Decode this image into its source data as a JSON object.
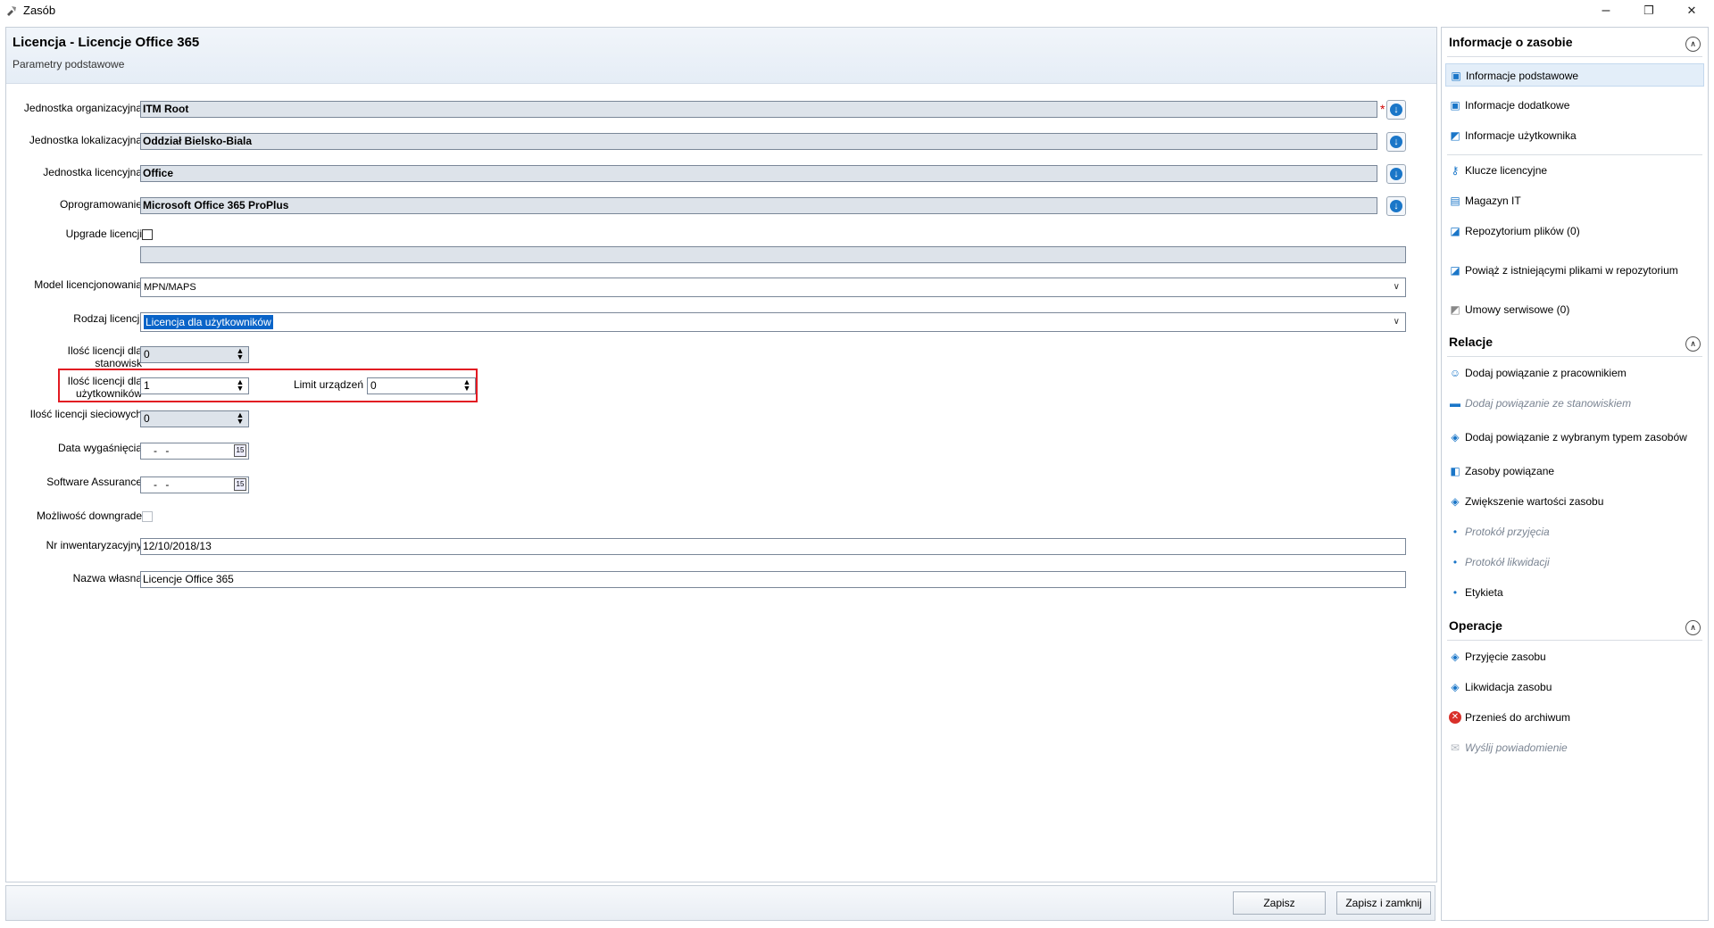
{
  "window": {
    "title": "Zasób",
    "minimize": "–",
    "restore": "❐",
    "close": "✕"
  },
  "header": {
    "title": "Licencja - Licencje Office 365",
    "subtitle": "Parametry podstawowe"
  },
  "form": {
    "jednostka_org": {
      "label": "Jednostka organizacyjna",
      "value": "ITM Root",
      "required": "*"
    },
    "jednostka_lok": {
      "label": "Jednostka lokalizacyjna",
      "value": "Oddział Bielsko-Biala"
    },
    "jednostka_lic": {
      "label": "Jednostka licencyjna",
      "value": "Office"
    },
    "oprogramowanie": {
      "label": "Oprogramowanie",
      "value": "Microsoft Office 365 ProPlus"
    },
    "upgrade": {
      "label": "Upgrade licencji"
    },
    "model": {
      "label": "Model licencjonowania",
      "value": "MPN/MAPS"
    },
    "rodzaj": {
      "label": "Rodzaj licencji",
      "value": "Licencja dla użytkowników"
    },
    "ilosc_stanowisk": {
      "label_line1": "Ilość licencji dla",
      "label_line2": "stanowisk",
      "value": "0"
    },
    "ilosc_uzytkownikow": {
      "label_line1": "Ilość licencji dla",
      "label_line2": "użytkowników",
      "value": "1"
    },
    "limit_urzadzen": {
      "label": "Limit urządzeń",
      "value": "0"
    },
    "ilosc_sieciowych": {
      "label": "Ilość licencji sieciowych",
      "value": "0"
    },
    "data_wygasniecia": {
      "label": "Data wygaśnięcia",
      "value": "- -"
    },
    "software_assurance": {
      "label": "Software Assurance",
      "value": "- -"
    },
    "downgrade": {
      "label": "Możliwość downgrade"
    },
    "nr_inwentaryzacyjny": {
      "label": "Nr inwentaryzacyjny",
      "value": "12/10/2018/13"
    },
    "nazwa_wlasna": {
      "label": "Nazwa własna",
      "value": "Licencje Office 365"
    }
  },
  "footer": {
    "save": "Zapisz",
    "save_close": "Zapisz i zamknij"
  },
  "side": {
    "info_title": "Informacje o zasobie",
    "info_items": [
      "Informacje podstawowe",
      "Informacje dodatkowe",
      "Informacje użytkownika"
    ],
    "info_items2": [
      "Klucze licencyjne",
      "Magazyn IT",
      "Repozytorium plików (0)",
      "Powiąż z istniejącymi plikami w repozytorium",
      "Umowy serwisowe (0)"
    ],
    "rel_title": "Relacje",
    "rel_items": [
      "Dodaj powiązanie z pracownikiem",
      "Dodaj powiązanie ze stanowiskiem",
      "Dodaj powiązanie z wybranym typem zasobów",
      "Zasoby powiązane",
      "Zwiększenie wartości zasobu",
      "Protokół przyjęcia",
      "Protokół likwidacji",
      "Etykieta"
    ],
    "op_title": "Operacje",
    "op_items": [
      "Przyjęcie zasobu",
      "Likwidacja zasobu",
      "Przenieś do archiwum",
      "Wyślij powiadomienie"
    ],
    "collapse_glyph": "∧"
  },
  "colors": {
    "accent": "#0a64c8",
    "highlight_box": "#e21a22",
    "field_bg": "#dde3ea"
  }
}
